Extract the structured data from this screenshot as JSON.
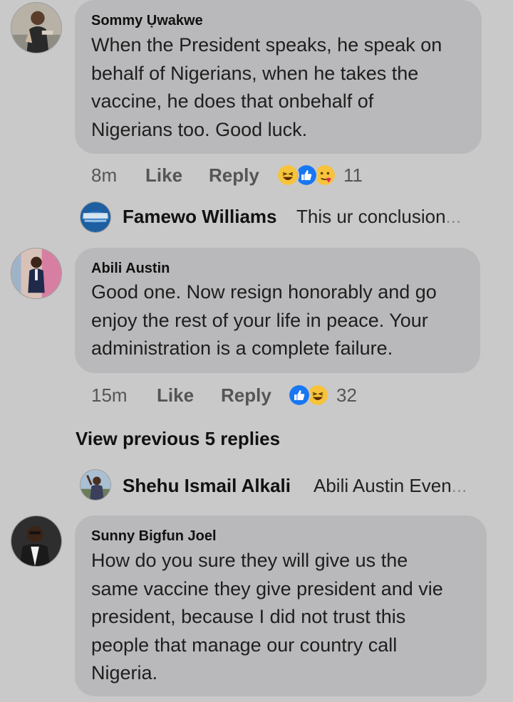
{
  "comments": [
    {
      "author": "Sommy Ụwakwe",
      "text": "When the President speaks, he speak on\nbehalf of Nigerians, when he takes the\nvaccine, he does that onbehalf of\nNigerians too. Good luck.",
      "time": "8m",
      "like_label": "Like",
      "reply_label": "Reply",
      "reactions": [
        "laugh-icon",
        "like-icon",
        "care-icon"
      ],
      "reaction_count": "11",
      "reply_preview": {
        "author": "Famewo Williams",
        "text": "This ur conclusion",
        "ellipsis": "..."
      }
    },
    {
      "author": "Abili Austin",
      "text": "Good one. Now resign honorably and go\nenjoy the rest of your life in peace. Your\nadministration is a complete failure.",
      "time": "15m",
      "like_label": "Like",
      "reply_label": "Reply",
      "reactions": [
        "like-icon",
        "laugh-icon"
      ],
      "reaction_count": "32",
      "view_previous": "View previous 5 replies",
      "reply_preview": {
        "author": "Shehu Ismail Alkali",
        "text": "Abili Austin Even",
        "ellipsis": "..."
      }
    },
    {
      "author": "Sunny Bigfun Joel",
      "text": "How do you sure they will give us the\nsame vaccine they give president and vie\npresident, because I did not trust this\npeople that manage our country call\nNigeria."
    }
  ],
  "colors": {
    "background": "#c9c9c9",
    "bubble": "#b9b9bb",
    "like_blue": "#1877f2",
    "laugh_yellow": "#f7c33b"
  }
}
